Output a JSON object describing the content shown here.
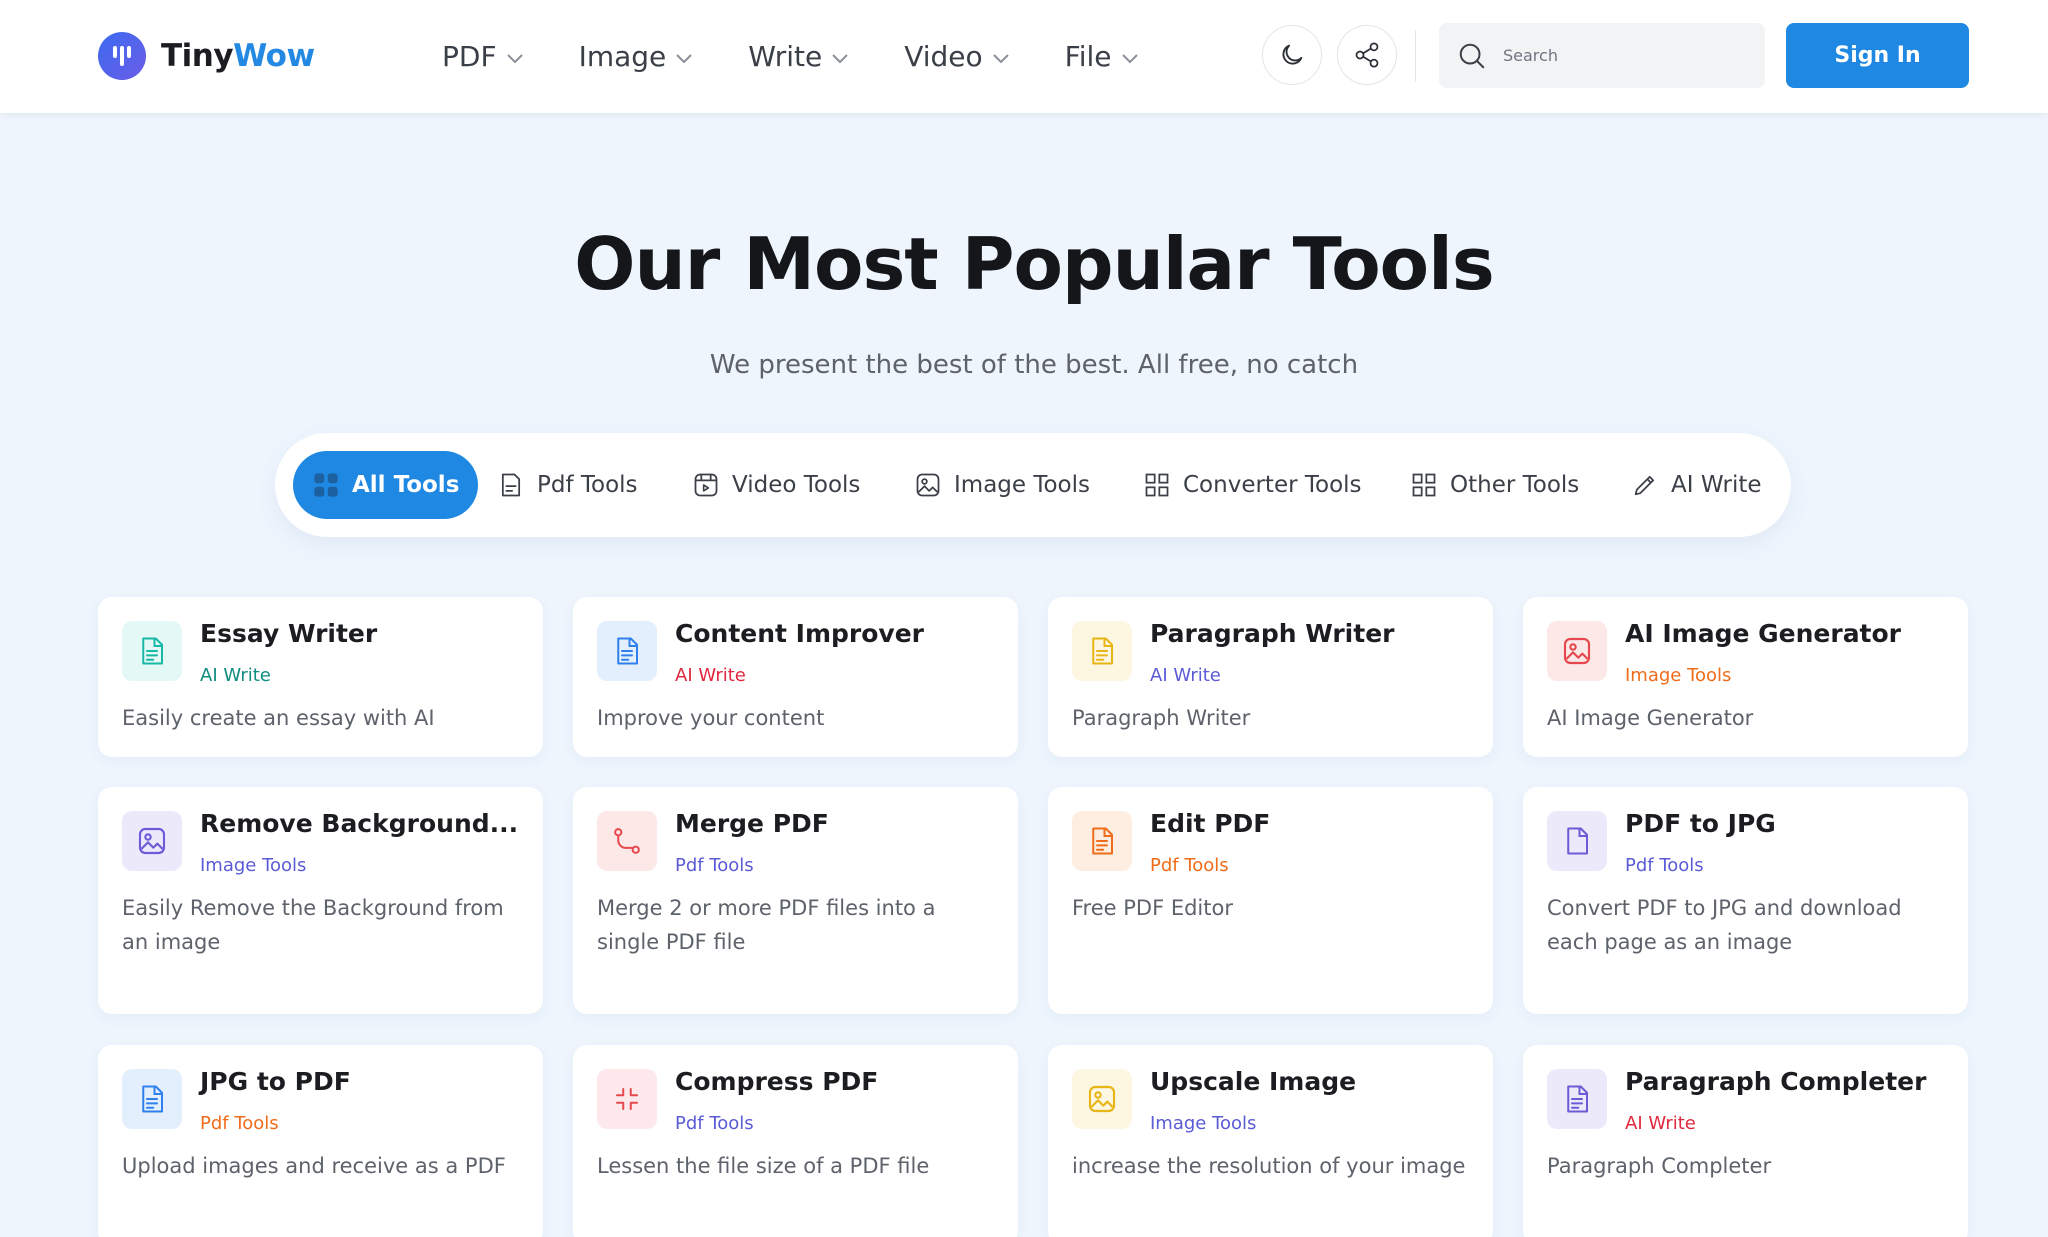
{
  "header": {
    "brand_a": "Tiny",
    "brand_b": "Wow",
    "nav": [
      {
        "label": "PDF"
      },
      {
        "label": "Image"
      },
      {
        "label": "Write"
      },
      {
        "label": "Video"
      },
      {
        "label": "File"
      }
    ],
    "search_placeholder": "Search",
    "signin_label": "Sign In"
  },
  "hero": {
    "title": "Our Most Popular Tools",
    "subtitle": "We present the best of the best. All free, no catch"
  },
  "filters": [
    {
      "label": "All Tools",
      "icon": "grid-dots-icon",
      "active": true
    },
    {
      "label": "Pdf Tools",
      "icon": "pdf-file-icon"
    },
    {
      "label": "Video Tools",
      "icon": "video-icon"
    },
    {
      "label": "Image Tools",
      "icon": "image-icon"
    },
    {
      "label": "Converter Tools",
      "icon": "grid-icon"
    },
    {
      "label": "Other Tools",
      "icon": "grid-icon"
    },
    {
      "label": "AI Write",
      "icon": "pencil-icon"
    }
  ],
  "colors": {
    "accent": "#1f88e3",
    "ai_write": "#5b5bd6",
    "ai_write_red": "#e2283e",
    "image_tools": "#5b5bd6",
    "image_tools_orange": "#ef6c1a",
    "pdf_tools": "#5b5bd6",
    "pdf_tools_orange": "#ef6c1a"
  },
  "cards": [
    {
      "title": "Essay Writer",
      "category": "AI Write",
      "description": "Easily create an essay with AI",
      "icon": "document-icon"
    },
    {
      "title": "Content Improver",
      "category": "AI Write",
      "description": "Improve your content",
      "icon": "document-icon"
    },
    {
      "title": "Paragraph Writer",
      "category": "AI Write",
      "description": "Paragraph Writer",
      "icon": "document-icon"
    },
    {
      "title": "AI Image Generator",
      "category": "Image Tools",
      "description": "AI Image Generator",
      "icon": "image-icon"
    },
    {
      "title": "Remove Background...",
      "category": "Image Tools",
      "description": "Easily Remove the Background from an image",
      "icon": "image-icon"
    },
    {
      "title": "Merge PDF",
      "category": "Pdf Tools",
      "description": "Merge 2 or more PDF files into a single PDF file",
      "icon": "merge-icon"
    },
    {
      "title": "Edit PDF",
      "category": "Pdf Tools",
      "description": "Free PDF Editor",
      "icon": "document-icon"
    },
    {
      "title": "PDF to JPG",
      "category": "Pdf Tools",
      "description": "Convert PDF to JPG and download each page as an image",
      "icon": "file-icon"
    },
    {
      "title": "JPG to PDF",
      "category": "Pdf Tools",
      "description": "Upload images and receive as a PDF",
      "icon": "document-icon"
    },
    {
      "title": "Compress PDF",
      "category": "Pdf Tools",
      "description": "Lessen the file size of a PDF file",
      "icon": "compress-icon"
    },
    {
      "title": "Upscale Image",
      "category": "Image Tools",
      "description": "increase the resolution of your image",
      "icon": "image-icon"
    },
    {
      "title": "Paragraph Completer",
      "category": "AI Write",
      "description": "Paragraph Completer",
      "icon": "document-icon"
    }
  ]
}
